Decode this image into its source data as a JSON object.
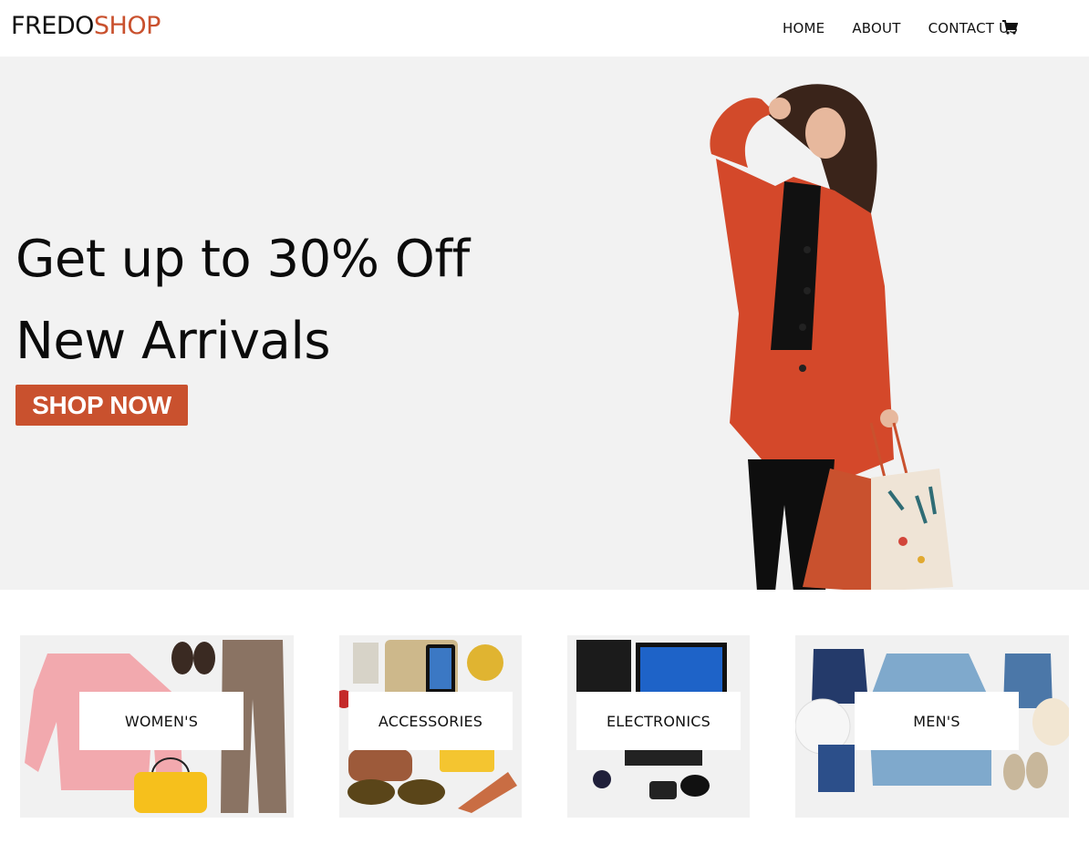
{
  "logo": {
    "part1": "FREDO",
    "part2": "SHOP"
  },
  "nav": {
    "home": "HOME",
    "about": "ABOUT",
    "contact": "CONTACT US",
    "cart_icon": "shopping-cart-icon"
  },
  "hero": {
    "line1": "Get up to 30% Off",
    "line2": "New Arrivals",
    "cta": "SHOP NOW"
  },
  "categories": [
    {
      "label": "WOMEN'S"
    },
    {
      "label": "ACCESSORIES"
    },
    {
      "label": "ELECTRONICS"
    },
    {
      "label": "MEN'S"
    }
  ],
  "colors": {
    "accent": "#c9512e",
    "hero_bg": "#f2f2f2",
    "card_bg": "#f1f1f1"
  }
}
